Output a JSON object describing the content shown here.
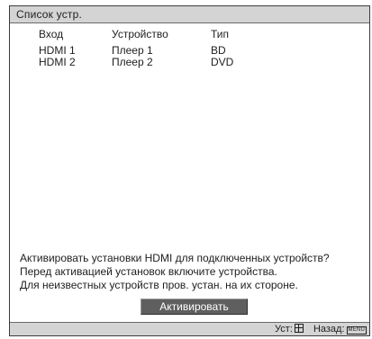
{
  "window": {
    "title": "Список устр."
  },
  "table": {
    "columns": [
      "Вход",
      "Устройство",
      "Тип"
    ],
    "rows": [
      [
        "HDMI 1",
        "Плеер 1",
        "BD"
      ],
      [
        "HDMI 2",
        "Плеер 2",
        "DVD"
      ]
    ]
  },
  "message": {
    "lines": [
      "Активировать установки HDMI для подключенных устройств?",
      "Перед активацией установок включите устройства.",
      "Для неизвестных устройств пров. устан. на их стороне."
    ]
  },
  "activate_button": {
    "label": "Активировать"
  },
  "footer": {
    "set_label": "Уст:",
    "set_icon": "enter-icon",
    "back_label": "Назад:",
    "back_key": "MENU"
  }
}
